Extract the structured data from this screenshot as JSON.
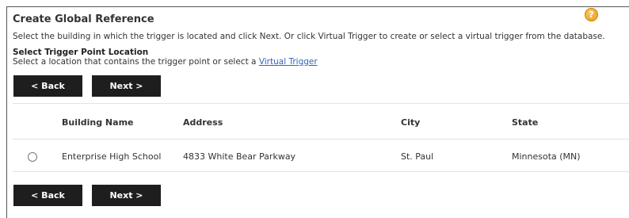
{
  "header": {
    "title": "Create Global Reference",
    "help_icon_glyph": "?",
    "description": "Select the building in which the trigger is located and click Next. Or click Virtual Trigger to create or select a virtual trigger from the database."
  },
  "section": {
    "heading": "Select Trigger Point Location",
    "text": "Select a location that contains the trigger point or select a ",
    "link": "Virtual Trigger"
  },
  "buttons": {
    "back": "< Back",
    "next": "Next >"
  },
  "table": {
    "columns": [
      "Building Name",
      "Address",
      "City",
      "State"
    ],
    "rows": [
      {
        "selected": false,
        "building_name": "Enterprise High School",
        "address": "4833 White Bear Parkway",
        "city": "St. Paul",
        "state": "Minnesota (MN)"
      }
    ]
  },
  "colors": {
    "button_bg": "#1e1e1e",
    "link": "#3366bb",
    "help_icon": "#e8960f"
  }
}
